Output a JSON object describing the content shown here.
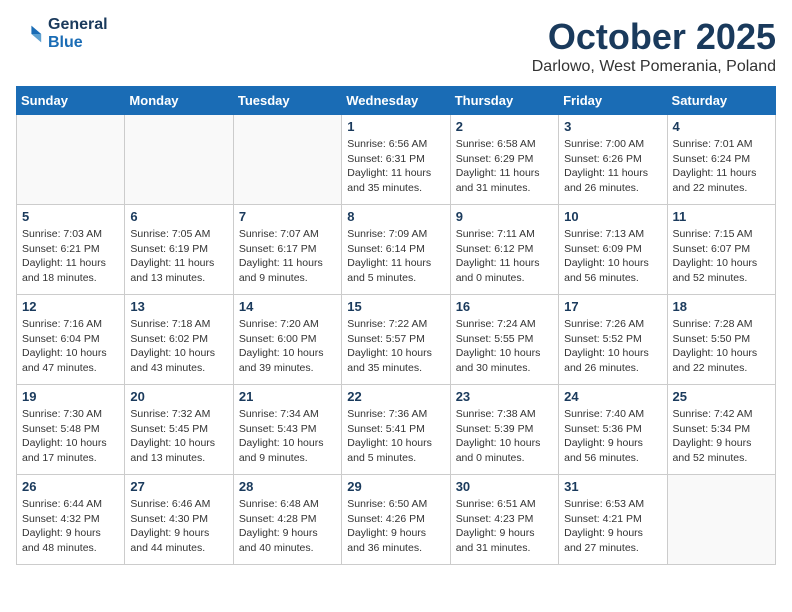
{
  "logo": {
    "line1": "General",
    "line2": "Blue"
  },
  "title": "October 2025",
  "location": "Darlowo, West Pomerania, Poland",
  "weekdays": [
    "Sunday",
    "Monday",
    "Tuesday",
    "Wednesday",
    "Thursday",
    "Friday",
    "Saturday"
  ],
  "weeks": [
    [
      {
        "day": "",
        "info": ""
      },
      {
        "day": "",
        "info": ""
      },
      {
        "day": "",
        "info": ""
      },
      {
        "day": "1",
        "info": "Sunrise: 6:56 AM\nSunset: 6:31 PM\nDaylight: 11 hours\nand 35 minutes."
      },
      {
        "day": "2",
        "info": "Sunrise: 6:58 AM\nSunset: 6:29 PM\nDaylight: 11 hours\nand 31 minutes."
      },
      {
        "day": "3",
        "info": "Sunrise: 7:00 AM\nSunset: 6:26 PM\nDaylight: 11 hours\nand 26 minutes."
      },
      {
        "day": "4",
        "info": "Sunrise: 7:01 AM\nSunset: 6:24 PM\nDaylight: 11 hours\nand 22 minutes."
      }
    ],
    [
      {
        "day": "5",
        "info": "Sunrise: 7:03 AM\nSunset: 6:21 PM\nDaylight: 11 hours\nand 18 minutes."
      },
      {
        "day": "6",
        "info": "Sunrise: 7:05 AM\nSunset: 6:19 PM\nDaylight: 11 hours\nand 13 minutes."
      },
      {
        "day": "7",
        "info": "Sunrise: 7:07 AM\nSunset: 6:17 PM\nDaylight: 11 hours\nand 9 minutes."
      },
      {
        "day": "8",
        "info": "Sunrise: 7:09 AM\nSunset: 6:14 PM\nDaylight: 11 hours\nand 5 minutes."
      },
      {
        "day": "9",
        "info": "Sunrise: 7:11 AM\nSunset: 6:12 PM\nDaylight: 11 hours\nand 0 minutes."
      },
      {
        "day": "10",
        "info": "Sunrise: 7:13 AM\nSunset: 6:09 PM\nDaylight: 10 hours\nand 56 minutes."
      },
      {
        "day": "11",
        "info": "Sunrise: 7:15 AM\nSunset: 6:07 PM\nDaylight: 10 hours\nand 52 minutes."
      }
    ],
    [
      {
        "day": "12",
        "info": "Sunrise: 7:16 AM\nSunset: 6:04 PM\nDaylight: 10 hours\nand 47 minutes."
      },
      {
        "day": "13",
        "info": "Sunrise: 7:18 AM\nSunset: 6:02 PM\nDaylight: 10 hours\nand 43 minutes."
      },
      {
        "day": "14",
        "info": "Sunrise: 7:20 AM\nSunset: 6:00 PM\nDaylight: 10 hours\nand 39 minutes."
      },
      {
        "day": "15",
        "info": "Sunrise: 7:22 AM\nSunset: 5:57 PM\nDaylight: 10 hours\nand 35 minutes."
      },
      {
        "day": "16",
        "info": "Sunrise: 7:24 AM\nSunset: 5:55 PM\nDaylight: 10 hours\nand 30 minutes."
      },
      {
        "day": "17",
        "info": "Sunrise: 7:26 AM\nSunset: 5:52 PM\nDaylight: 10 hours\nand 26 minutes."
      },
      {
        "day": "18",
        "info": "Sunrise: 7:28 AM\nSunset: 5:50 PM\nDaylight: 10 hours\nand 22 minutes."
      }
    ],
    [
      {
        "day": "19",
        "info": "Sunrise: 7:30 AM\nSunset: 5:48 PM\nDaylight: 10 hours\nand 17 minutes."
      },
      {
        "day": "20",
        "info": "Sunrise: 7:32 AM\nSunset: 5:45 PM\nDaylight: 10 hours\nand 13 minutes."
      },
      {
        "day": "21",
        "info": "Sunrise: 7:34 AM\nSunset: 5:43 PM\nDaylight: 10 hours\nand 9 minutes."
      },
      {
        "day": "22",
        "info": "Sunrise: 7:36 AM\nSunset: 5:41 PM\nDaylight: 10 hours\nand 5 minutes."
      },
      {
        "day": "23",
        "info": "Sunrise: 7:38 AM\nSunset: 5:39 PM\nDaylight: 10 hours\nand 0 minutes."
      },
      {
        "day": "24",
        "info": "Sunrise: 7:40 AM\nSunset: 5:36 PM\nDaylight: 9 hours\nand 56 minutes."
      },
      {
        "day": "25",
        "info": "Sunrise: 7:42 AM\nSunset: 5:34 PM\nDaylight: 9 hours\nand 52 minutes."
      }
    ],
    [
      {
        "day": "26",
        "info": "Sunrise: 6:44 AM\nSunset: 4:32 PM\nDaylight: 9 hours\nand 48 minutes."
      },
      {
        "day": "27",
        "info": "Sunrise: 6:46 AM\nSunset: 4:30 PM\nDaylight: 9 hours\nand 44 minutes."
      },
      {
        "day": "28",
        "info": "Sunrise: 6:48 AM\nSunset: 4:28 PM\nDaylight: 9 hours\nand 40 minutes."
      },
      {
        "day": "29",
        "info": "Sunrise: 6:50 AM\nSunset: 4:26 PM\nDaylight: 9 hours\nand 36 minutes."
      },
      {
        "day": "30",
        "info": "Sunrise: 6:51 AM\nSunset: 4:23 PM\nDaylight: 9 hours\nand 31 minutes."
      },
      {
        "day": "31",
        "info": "Sunrise: 6:53 AM\nSunset: 4:21 PM\nDaylight: 9 hours\nand 27 minutes."
      },
      {
        "day": "",
        "info": ""
      }
    ]
  ]
}
